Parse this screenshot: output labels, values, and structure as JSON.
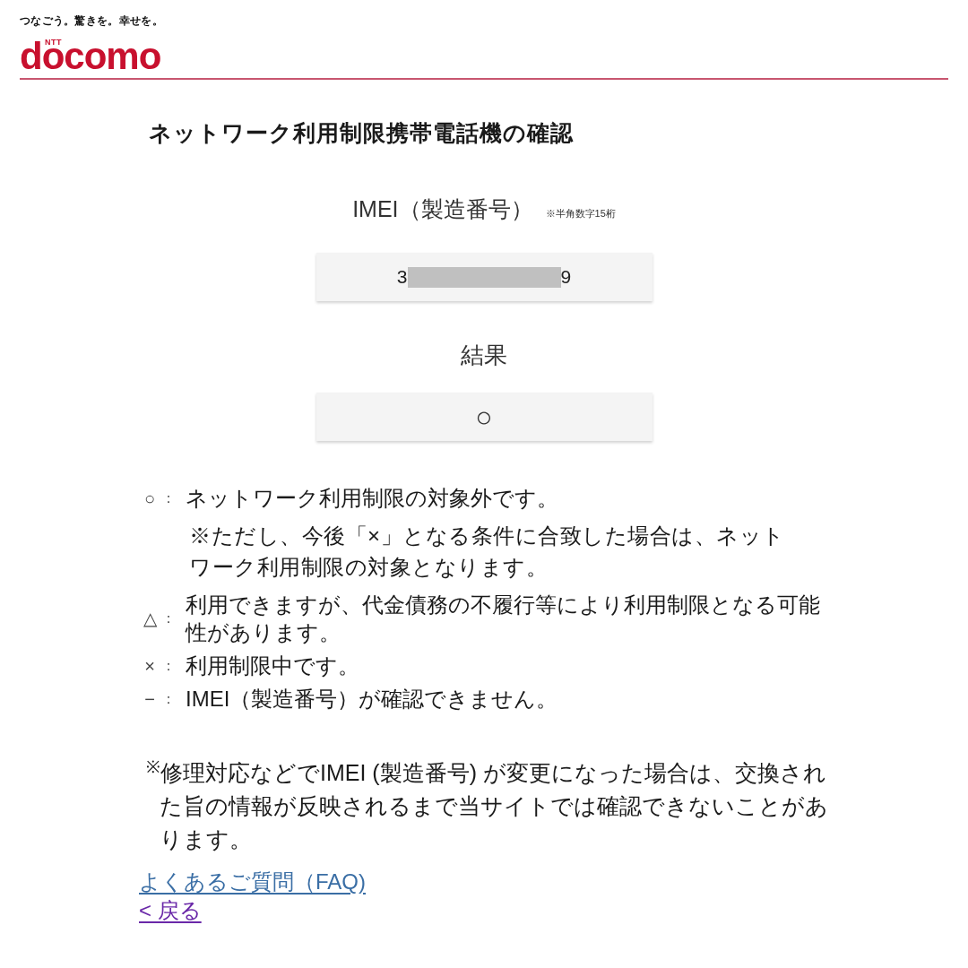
{
  "header": {
    "tagline": "つなごう。驚きを。幸せを。",
    "logo": {
      "super": "NTT",
      "name": "docomo"
    }
  },
  "title": "ネットワーク利用制限携帯電話機の確認",
  "imei": {
    "label": "IMEI（製造番号）",
    "hint": "※半角数字15桁",
    "value_start": "3",
    "value_end": "9",
    "redacted": true
  },
  "result": {
    "label": "結果",
    "value": "○"
  },
  "legend": [
    {
      "mark": "○",
      "separator": "：",
      "text": "ネットワーク利用制限の対象外です。",
      "note": "※ただし、今後「×」となる条件に合致した場合は、ネットワーク利用制限の対象となります。"
    },
    {
      "mark": "△",
      "separator": "：",
      "text": "利用できますが、代金債務の不履行等により利用制限となる可能性があります。"
    },
    {
      "mark": "×",
      "separator": "：",
      "text": "利用制限中です。"
    },
    {
      "mark": "−",
      "separator": "：",
      "text": "IMEI（製造番号）が確認できません。"
    }
  ],
  "footnote": "$^{※}$修理対応などでIMEI (製造番号) が変更になった場合は、交換された旨の情報が反映されるまで当サイトでは確認できないことがあります。",
  "links": [
    {
      "label": "よくあるご質問（FAQ)",
      "visited": false
    },
    {
      "label": "< 戻る",
      "visited": true
    }
  ]
}
